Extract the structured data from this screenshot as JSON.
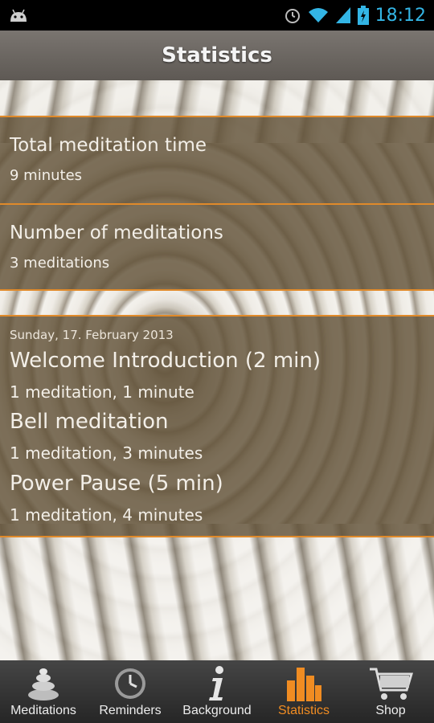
{
  "status_bar": {
    "time": "18:12",
    "icons": [
      "android-icon",
      "alarm-icon",
      "wifi-icon",
      "signal-icon",
      "battery-charging-icon"
    ]
  },
  "header": {
    "title": "Statistics"
  },
  "stats": {
    "total_time": {
      "label": "Total meditation time",
      "value": "9 minutes"
    },
    "count": {
      "label": "Number of meditations",
      "value": "3 meditations"
    }
  },
  "history": {
    "date": "Sunday, 17. February 2013",
    "entries": [
      {
        "title": "Welcome Introduction (2 min)",
        "detail": "1 meditation, 1 minute"
      },
      {
        "title": "Bell meditation",
        "detail": "1 meditation, 3 minutes"
      },
      {
        "title": "Power Pause (5 min)",
        "detail": "1 meditation, 4 minutes"
      }
    ]
  },
  "nav": {
    "items": [
      {
        "label": "Meditations",
        "icon": "stones-icon"
      },
      {
        "label": "Reminders",
        "icon": "clock-icon"
      },
      {
        "label": "Background",
        "icon": "info-icon"
      },
      {
        "label": "Statistics",
        "icon": "bar-chart-icon",
        "active": true
      },
      {
        "label": "Shop",
        "icon": "cart-icon"
      }
    ]
  },
  "colors": {
    "accent": "#f08c22",
    "panel": "#625238",
    "status_time": "#33b5e5"
  }
}
